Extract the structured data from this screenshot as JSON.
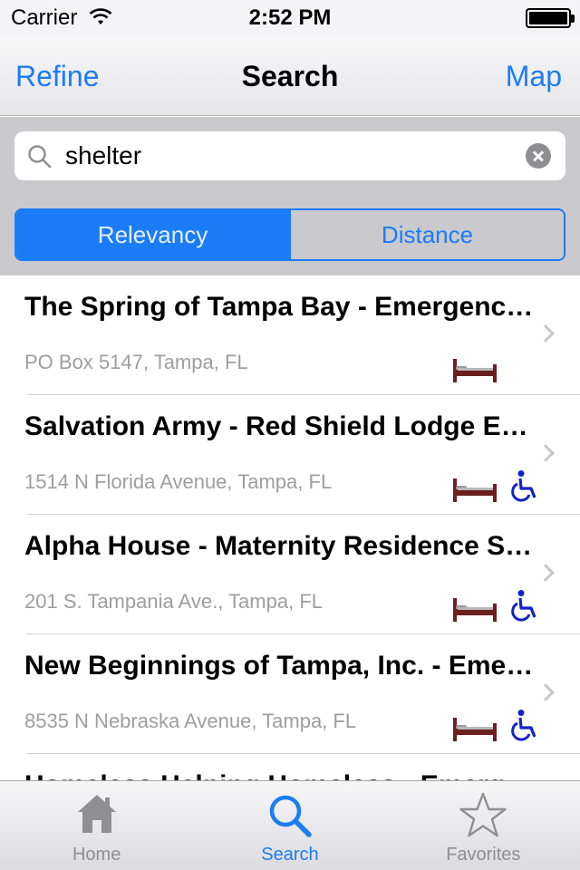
{
  "status_bar": {
    "carrier": "Carrier",
    "time": "2:52 PM"
  },
  "nav": {
    "left_label": "Refine",
    "title": "Search",
    "right_label": "Map"
  },
  "search": {
    "value": "shelter"
  },
  "segments": [
    "Relevancy",
    "Distance"
  ],
  "results": [
    {
      "title": "The Spring of Tampa Bay - Emergency Shelter",
      "address": "PO Box 5147, Tampa, FL",
      "icons": [
        "bed-icon"
      ]
    },
    {
      "title": "Salvation Army - Red Shield Lodge Emergency Shelter",
      "address": "1514 N Florida Avenue, Tampa, FL",
      "icons": [
        "bed-icon",
        "wheelchair-icon"
      ]
    },
    {
      "title": "Alpha House - Maternity Residence Shelter",
      "address": "201 S. Tampania Ave., Tampa, FL",
      "icons": [
        "bed-icon",
        "wheelchair-icon"
      ]
    },
    {
      "title": "New Beginnings of Tampa, Inc. - Emergency Shelter",
      "address": "8535 N Nebraska Avenue, Tampa, FL",
      "icons": [
        "bed-icon",
        "wheelchair-icon"
      ]
    },
    {
      "title": "Homeless Helping Homeless - Emergency Shelter",
      "address": "",
      "icons": []
    }
  ],
  "tabs": [
    {
      "label": "Home",
      "icon": "house-icon",
      "active": false
    },
    {
      "label": "Search",
      "icon": "search-icon",
      "active": true
    },
    {
      "label": "Favorites",
      "icon": "star-icon",
      "active": false
    }
  ],
  "colors": {
    "accent": "#1b7cf7",
    "bed": "#6b1f1f",
    "wheelchair": "#1222c8"
  }
}
